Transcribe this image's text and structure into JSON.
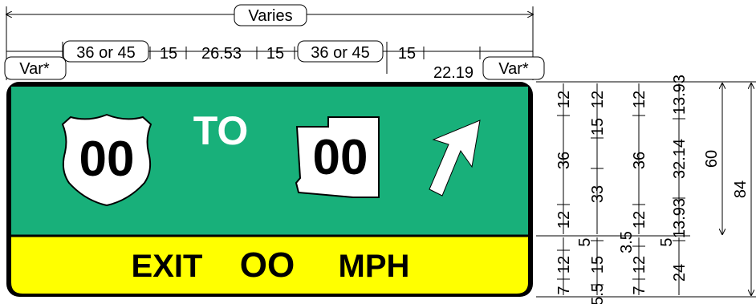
{
  "top_dimensions": {
    "overall": "Varies",
    "shield_space_left": "36 or 45",
    "gap_1": "15",
    "to_word": "26.53",
    "gap_2": "15",
    "shield_space_right": "36 or 45",
    "gap_3": "15",
    "arrow_space": "22.19",
    "edge_left": "Var*",
    "edge_right": "Var*"
  },
  "sign": {
    "route_left": "00",
    "to_text": "TO",
    "route_right": "00",
    "exit_text": "EXIT",
    "speed_value": "OO",
    "speed_unit": "MPH",
    "colors": {
      "panel_green": "#18b07a",
      "panel_yellow": "#ffff00",
      "border": "#000000",
      "legend_white": "#ffffff"
    }
  },
  "side_dimensions": {
    "col1": [
      "12",
      "36",
      "12"
    ],
    "col2": [
      "15",
      "33"
    ],
    "col3": [
      "12",
      "36",
      "12"
    ],
    "col4": [
      "13.93",
      "32.14",
      "13.93"
    ],
    "panel_height": "60",
    "total_height": "84",
    "lower_col1": [
      "12",
      "7"
    ],
    "lower_col2": [
      "5",
      "15",
      "5.5"
    ],
    "lower_col3": [
      "3.5",
      "12",
      "7"
    ],
    "lower_col4": [
      "5",
      "24"
    ]
  }
}
